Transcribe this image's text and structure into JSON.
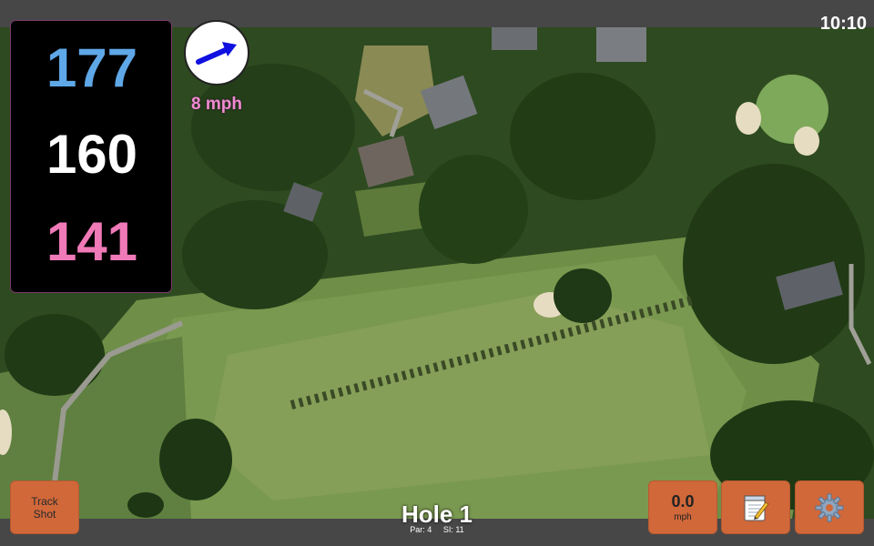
{
  "status": {
    "time": "10:10"
  },
  "distances": {
    "back": "177",
    "middle": "160",
    "front": "141"
  },
  "wind": {
    "speed_label": "8 mph",
    "direction_icon": "arrow-icon"
  },
  "hole": {
    "title": "Hole 1",
    "par": "Par: 4",
    "si": "SI: 11"
  },
  "buttons": {
    "track_line1": "Track",
    "track_line2": "Shot",
    "speed_value": "0.0",
    "speed_unit": "mph",
    "notes_icon": "notepad-icon",
    "settings_icon": "gear-icon"
  },
  "colors": {
    "back": "#5fa8e8",
    "middle": "#ffffff",
    "front": "#f07ab8",
    "wind_text": "#f08ad0",
    "button": "#d0683a",
    "arrow": "#1010e0"
  }
}
